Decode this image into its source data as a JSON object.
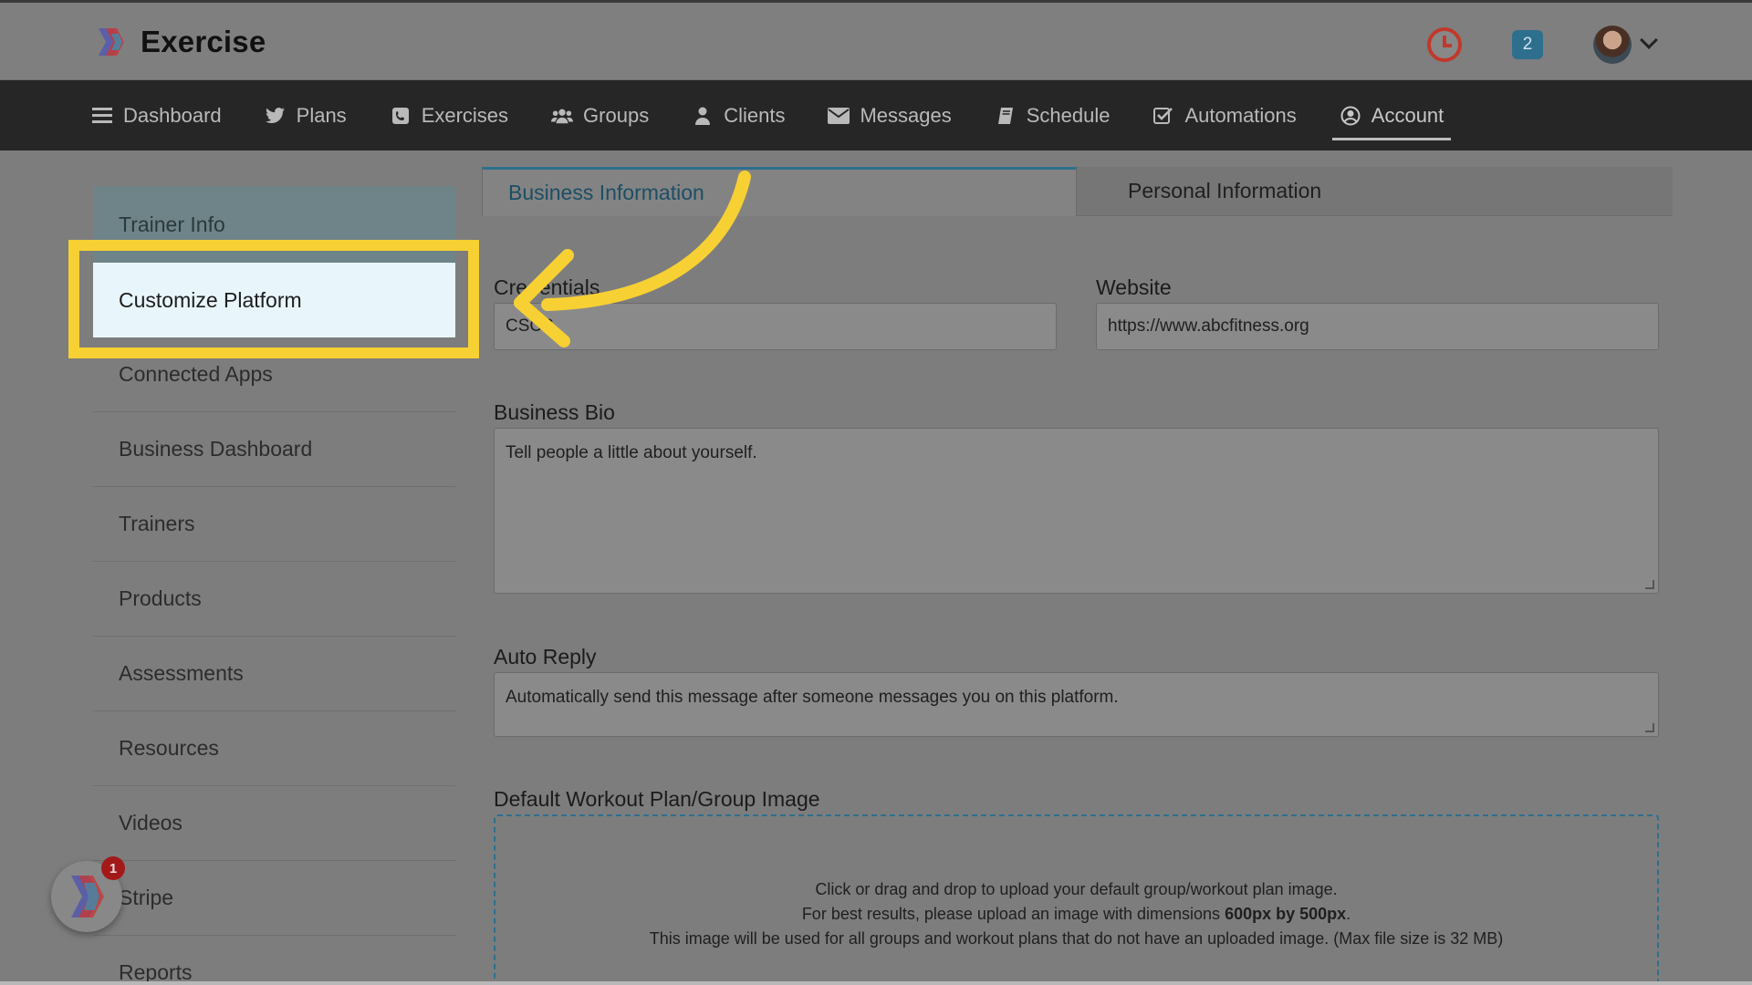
{
  "app": {
    "name": "Exercise"
  },
  "header": {
    "notification_count": "2"
  },
  "nav": {
    "items": [
      {
        "label": "Dashboard",
        "icon": "list-icon"
      },
      {
        "label": "Plans",
        "icon": "bird-icon"
      },
      {
        "label": "Exercises",
        "icon": "phone-book-icon"
      },
      {
        "label": "Groups",
        "icon": "users-icon"
      },
      {
        "label": "Clients",
        "icon": "user-icon"
      },
      {
        "label": "Messages",
        "icon": "envelope-icon"
      },
      {
        "label": "Schedule",
        "icon": "book-icon"
      },
      {
        "label": "Automations",
        "icon": "check-square-icon"
      },
      {
        "label": "Account",
        "icon": "user-circle-icon",
        "active": true
      }
    ]
  },
  "sidebar": {
    "items": [
      {
        "label": "Trainer Info"
      },
      {
        "label": "Customize Platform"
      },
      {
        "label": "Connected Apps"
      },
      {
        "label": "Business Dashboard"
      },
      {
        "label": "Trainers"
      },
      {
        "label": "Products"
      },
      {
        "label": "Assessments"
      },
      {
        "label": "Resources"
      },
      {
        "label": "Videos"
      },
      {
        "label": "Stripe"
      },
      {
        "label": "Reports"
      }
    ]
  },
  "tabs": [
    {
      "label": "Business Information",
      "active": true
    },
    {
      "label": "Personal Information",
      "active": false
    }
  ],
  "form": {
    "credentials": {
      "label": "Credentials",
      "value": "CSCS"
    },
    "website": {
      "label": "Website",
      "value": "https://www.abcfitness.org"
    },
    "bio": {
      "label": "Business Bio",
      "placeholder": "Tell people a little about yourself."
    },
    "auto_reply": {
      "label": "Auto Reply",
      "placeholder": "Automatically send this message after someone messages you on this platform."
    },
    "default_image": {
      "label": "Default Workout Plan/Group Image",
      "line1": "Click or drag and drop to upload your default group/workout plan image.",
      "line2_pre": "For best results, please upload an image with dimensions ",
      "line2_bold": "600px by 500px",
      "line2_post": ".",
      "line3": "This image will be used for all groups and workout plans that do not have an uploaded image. (Max file size is 32 MB)"
    }
  },
  "widget": {
    "badge": "1"
  },
  "colors": {
    "accent": "#2e6f8e",
    "highlight": "#f7d033",
    "nav_bg": "#262626"
  }
}
